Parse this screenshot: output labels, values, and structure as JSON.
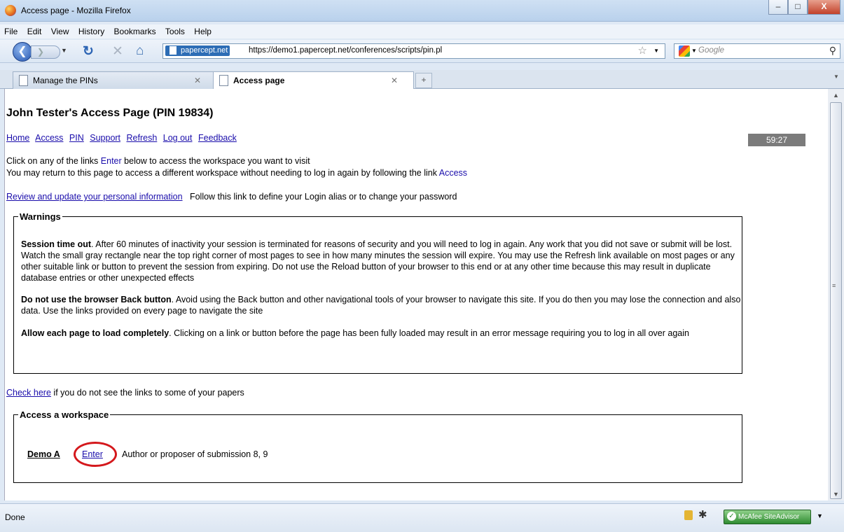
{
  "window": {
    "title": "Access page - Mozilla Firefox",
    "buttons": {
      "minimize": "–",
      "maximize": "□",
      "close": "X"
    }
  },
  "menubar": {
    "items": [
      "File",
      "Edit",
      "View",
      "History",
      "Bookmarks",
      "Tools",
      "Help"
    ]
  },
  "navbar": {
    "site_badge": "papercept.net",
    "url": "https://demo1.papercept.net/conferences/scripts/pin.pl",
    "search_placeholder": "Google"
  },
  "tabs": [
    {
      "label": "Manage the PINs",
      "active": false
    },
    {
      "label": "Access page",
      "active": true
    }
  ],
  "page": {
    "title": "John Tester's Access Page (PIN 19834)",
    "nav_links": [
      "Home",
      "Access",
      "PIN",
      "Support",
      "Refresh",
      "Log out",
      "Feedback"
    ],
    "timer": "59:27",
    "intro": {
      "line1_pre": "Click on any of the links ",
      "line1_link": "Enter",
      "line1_post": " below to access the workspace you want to visit",
      "line2_pre": "You may return to this page to access a different workspace without needing to log in again by following the link ",
      "line2_link": "Access"
    },
    "personal": {
      "link": "Review and update your personal information",
      "text": "Follow this link to define your Login alias or to change your password"
    },
    "warnings": {
      "legend": "Warnings",
      "items": [
        {
          "bold": "Session time out",
          "text": ". After 60 minutes of inactivity your session is terminated for reasons of security and you will need to log in again. Any work that you did not save or submit will be lost. Watch the small gray rectangle near the top right corner of most pages to see in how many minutes the session will expire. You may use the Refresh link available on most pages or any other suitable link or button to prevent the session from expiring. Do not use the Reload button of your browser to this end or at any other time because this may result in duplicate database entries or other unexpected effects"
        },
        {
          "bold": "Do not use the browser Back button",
          "text": ". Avoid using the Back button and other navigational tools of your browser to navigate this site. If you do then you may lose the connection and also data. Use the links provided on every page to navigate the site"
        },
        {
          "bold": "Allow each page to load completely",
          "text": ". Clicking on a link or button before the page has been fully loaded may result in an error message requiring you to log in all over again"
        }
      ]
    },
    "check": {
      "link": "Check here",
      "text": " if you do not see the links to some of your papers"
    },
    "workspace": {
      "legend": "Access a workspace",
      "name": "Demo A",
      "enter": "Enter",
      "description": "Author or proposer of submission 8, 9"
    }
  },
  "statusbar": {
    "text": "Done",
    "mcafee": "McAfee SiteAdvisor"
  }
}
